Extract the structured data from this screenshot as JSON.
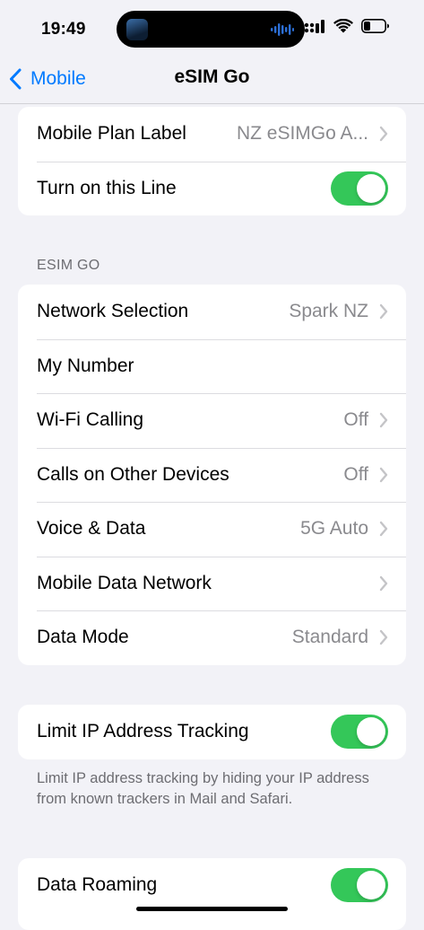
{
  "status_bar": {
    "time": "19:49"
  },
  "nav": {
    "back_label": "Mobile",
    "title": "eSIM Go"
  },
  "group1": {
    "rows": [
      {
        "label": "Mobile Plan Label",
        "value": "NZ eSIMGo A..."
      },
      {
        "label": "Turn on this Line",
        "toggle_on": true
      }
    ]
  },
  "section": {
    "header": "ESIM GO"
  },
  "group2": {
    "rows": [
      {
        "label": "Network Selection",
        "value": "Spark NZ"
      },
      {
        "label": "My Number",
        "value": ""
      },
      {
        "label": "Wi-Fi Calling",
        "value": "Off"
      },
      {
        "label": "Calls on Other Devices",
        "value": "Off"
      },
      {
        "label": "Voice & Data",
        "value": "5G Auto"
      },
      {
        "label": "Mobile Data Network",
        "value": ""
      },
      {
        "label": "Data Mode",
        "value": "Standard"
      }
    ]
  },
  "group3": {
    "label": "Limit IP Address Tracking",
    "toggle_on": true,
    "footnote": "Limit IP address tracking by hiding your IP address from known trackers in Mail and Safari."
  },
  "group4": {
    "label": "Data Roaming",
    "toggle_on": true
  },
  "colors": {
    "accent": "#007aff",
    "toggle_on": "#34c759",
    "background": "#f2f2f7",
    "secondary_text": "#8a8a8e"
  }
}
